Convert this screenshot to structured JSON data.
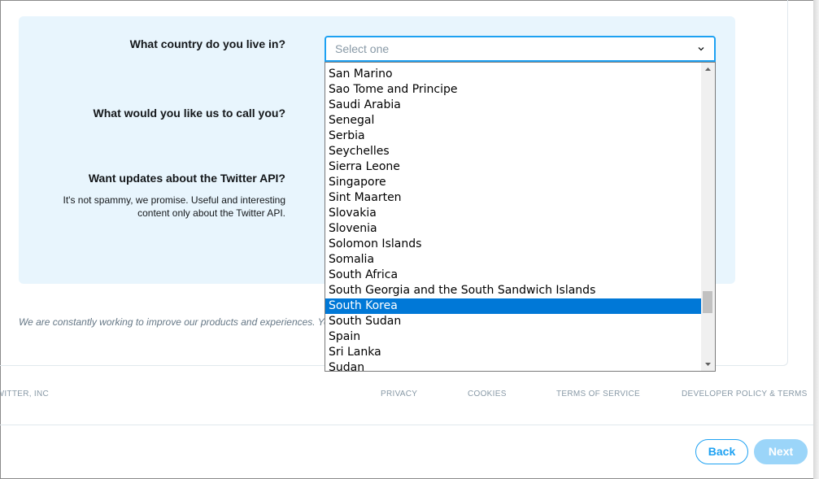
{
  "form": {
    "country_question": "What country do you live in?",
    "name_question": "What would you like us to call you?",
    "updates_question": "Want updates about the Twitter API?",
    "updates_help_line1": "It's not spammy, we promise. Useful and interesting",
    "updates_help_line2": "content only about the Twitter API.",
    "country_select": {
      "placeholder": "Select one",
      "options": [
        "San Marino",
        "Sao Tome and Principe",
        "Saudi Arabia",
        "Senegal",
        "Serbia",
        "Seychelles",
        "Sierra Leone",
        "Singapore",
        "Sint Maarten",
        "Slovakia",
        "Slovenia",
        "Solomon Islands",
        "Somalia",
        "South Africa",
        "South Georgia and the South Sandwich Islands",
        "South Korea",
        "South Sudan",
        "Spain",
        "Sri Lanka",
        "Sudan"
      ],
      "highlighted_option": "South Korea"
    }
  },
  "notice": "We are constantly working to improve our products and experiences. You",
  "footer": {
    "company": "TWITTER, INC",
    "privacy": "PRIVACY",
    "cookies": "COOKIES",
    "terms": "TERMS OF SERVICE",
    "developer_policy": "DEVELOPER POLICY & TERMS"
  },
  "buttons": {
    "back": "Back",
    "next": "Next"
  },
  "colors": {
    "accent": "#1da1f2",
    "panel_bg": "#e8f5fd",
    "selection": "#0078d7",
    "next_disabled": "#9bd5f9"
  }
}
